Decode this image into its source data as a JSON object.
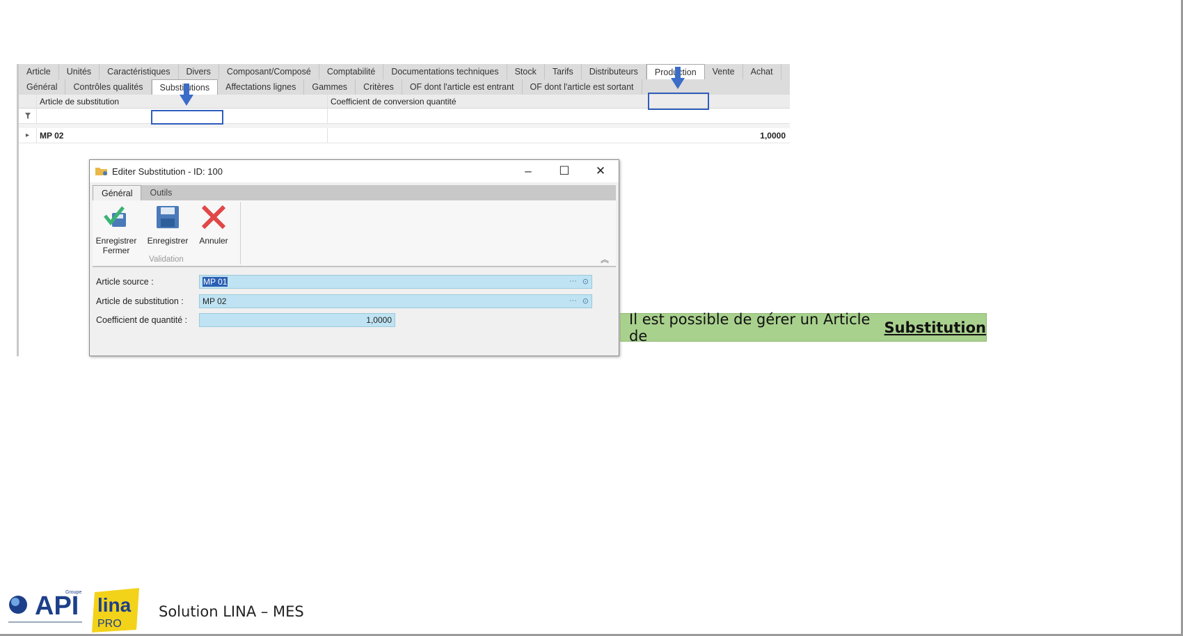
{
  "main_tabs": [
    "Article",
    "Unités",
    "Caractéristiques",
    "Divers",
    "Composant/Composé",
    "Comptabilité",
    "Documentations techniques",
    "Stock",
    "Tarifs",
    "Distributeurs",
    "Production",
    "Vente",
    "Achat"
  ],
  "main_tabs_active": "Production",
  "sub_tabs": [
    "Général",
    "Contrôles qualités",
    "Substitutions",
    "Affectations lignes",
    "Gammes",
    "Critères",
    "OF dont l'article est entrant",
    "OF dont l'article est sortant"
  ],
  "sub_tabs_active": "Substitutions",
  "grid": {
    "columns": [
      "Article de substitution",
      "Coefficient de conversion quantité"
    ],
    "filter_icon": "filter-icon",
    "rows": [
      {
        "article": "MP 02",
        "coefficient": "1,0000"
      }
    ]
  },
  "dialog": {
    "title": "Editer Substitution - ID: 100",
    "ribbon_tabs": [
      "Général",
      "Outils"
    ],
    "buttons": {
      "save_close": "Enregistrer Fermer",
      "save": "Enregistrer",
      "cancel": "Annuler"
    },
    "group_label": "Validation",
    "fields": {
      "source_label": "Article source :",
      "source_value": "MP 01",
      "substitution_label": "Article de substitution :",
      "substitution_value": "MP 02",
      "coef_label": "Coefficient de quantité :",
      "coef_value": "1,0000"
    }
  },
  "callout": {
    "text": "Il est possible de gérer un Article de",
    "emphasis": "Substitution"
  },
  "footer": {
    "logo_api": "API",
    "logo_api_small": "Groupe",
    "logo_lina": "lina",
    "logo_pro": "PRO",
    "text": "Solution LINA – MES"
  },
  "colors": {
    "callout_bg": "#a9d18e",
    "highlight_box": "#2e5dbd",
    "input_bg": "#bfe3f2",
    "arrow": "#3a6cc8"
  }
}
